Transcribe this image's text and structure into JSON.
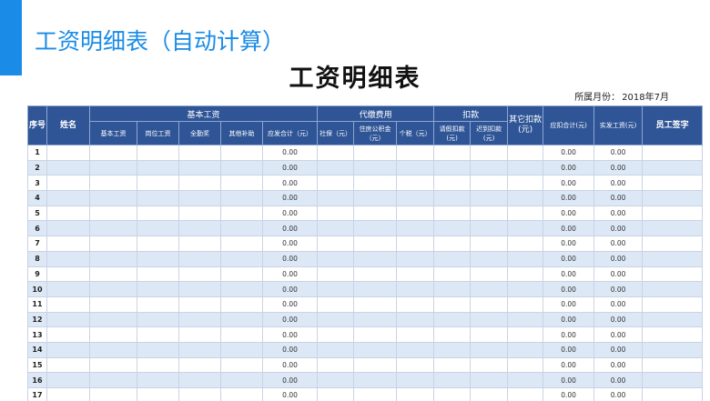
{
  "slide_title": "工资明细表（自动计算）",
  "doc_title": "工资明细表",
  "month_label": "所属月份：",
  "month_value": "2018年7月",
  "header": {
    "seq": "序号",
    "name": "姓名",
    "basic_group": "基本工资",
    "basic_cols": [
      "基本工资",
      "岗位工资",
      "全勤奖",
      "其他补助",
      "应发合计（元）"
    ],
    "deduct_group": "代缴费用",
    "deduct_cols": [
      "社保（元）",
      "住房公积金（元）",
      "个税（元）"
    ],
    "kou_group": "扣款",
    "kou_cols": [
      "请假扣款(元)",
      "迟到扣款(元)"
    ],
    "other_deduct": "其它扣款(元)",
    "total_deduct": "应扣合计(元)",
    "net_pay": "实发工资(元)",
    "signature": "员工签字"
  },
  "rows": [
    {
      "no": "1",
      "gross": "0.00",
      "deduct_total": "0.00",
      "net": "0.00"
    },
    {
      "no": "2",
      "gross": "0.00",
      "deduct_total": "0.00",
      "net": "0.00"
    },
    {
      "no": "3",
      "gross": "0.00",
      "deduct_total": "0.00",
      "net": "0.00"
    },
    {
      "no": "4",
      "gross": "0.00",
      "deduct_total": "0.00",
      "net": "0.00"
    },
    {
      "no": "5",
      "gross": "0.00",
      "deduct_total": "0.00",
      "net": "0.00"
    },
    {
      "no": "6",
      "gross": "0.00",
      "deduct_total": "0.00",
      "net": "0.00"
    },
    {
      "no": "7",
      "gross": "0.00",
      "deduct_total": "0.00",
      "net": "0.00"
    },
    {
      "no": "8",
      "gross": "0.00",
      "deduct_total": "0.00",
      "net": "0.00"
    },
    {
      "no": "9",
      "gross": "0.00",
      "deduct_total": "0.00",
      "net": "0.00"
    },
    {
      "no": "10",
      "gross": "0.00",
      "deduct_total": "0.00",
      "net": "0.00"
    },
    {
      "no": "11",
      "gross": "0.00",
      "deduct_total": "0.00",
      "net": "0.00"
    },
    {
      "no": "12",
      "gross": "0.00",
      "deduct_total": "0.00",
      "net": "0.00"
    },
    {
      "no": "13",
      "gross": "0.00",
      "deduct_total": "0.00",
      "net": "0.00"
    },
    {
      "no": "14",
      "gross": "0.00",
      "deduct_total": "0.00",
      "net": "0.00"
    },
    {
      "no": "15",
      "gross": "0.00",
      "deduct_total": "0.00",
      "net": "0.00"
    },
    {
      "no": "16",
      "gross": "0.00",
      "deduct_total": "0.00",
      "net": "0.00"
    },
    {
      "no": "17",
      "gross": "0.00",
      "deduct_total": "0.00",
      "net": "0.00"
    }
  ]
}
